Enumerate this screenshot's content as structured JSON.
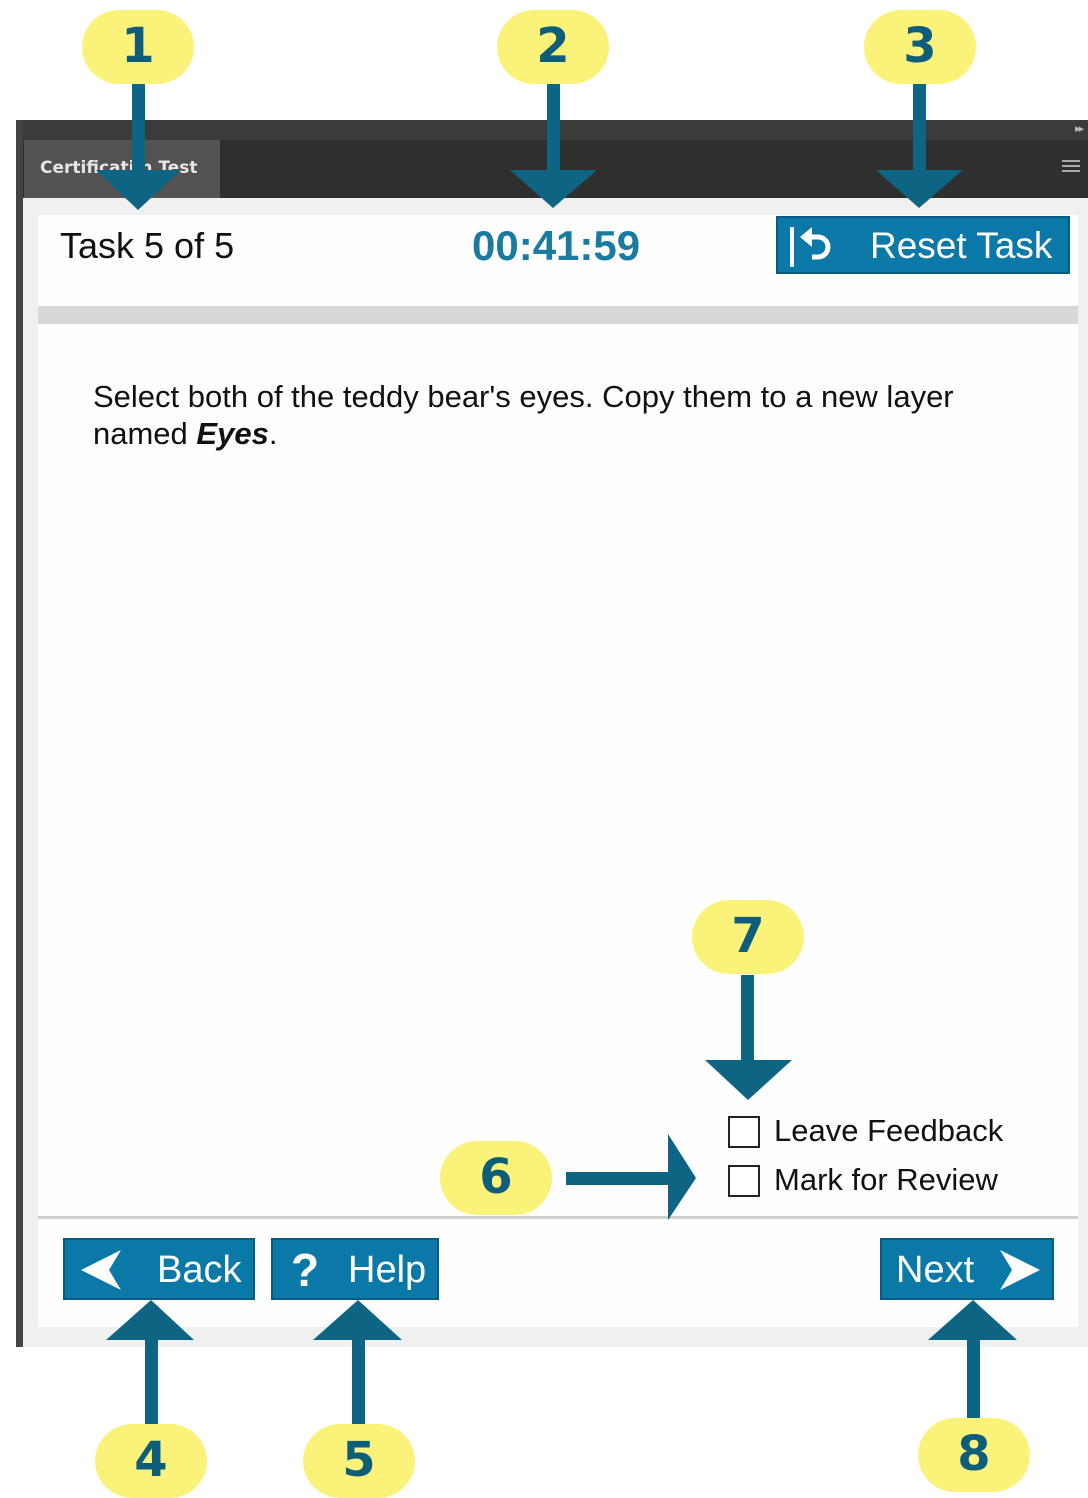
{
  "panel": {
    "tab_label": "Certificati n Test"
  },
  "header": {
    "task_counter": "Task 5 of 5",
    "timer": "00:41:59",
    "reset_label": "Reset Task"
  },
  "task": {
    "instruction_text": "Select both of the teddy bear's eyes. Copy them to a new layer named ",
    "layer_name": "Eyes",
    "end_punct": "."
  },
  "options": {
    "leave_feedback": "Leave Feedback",
    "mark_for_review": "Mark for Review"
  },
  "footer": {
    "back_label": "Back",
    "help_label": "Help",
    "next_label": "Next"
  },
  "callouts": [
    "1",
    "2",
    "3",
    "4",
    "5",
    "6",
    "7",
    "8"
  ],
  "colors": {
    "accent": "#0a79a8",
    "timer": "#1a7aa0",
    "callout_fill": "#fbf27a",
    "callout_arrow": "#0e6483"
  },
  "icons": {
    "reset": "reset-icon",
    "back": "back-arrow-icon",
    "help": "help-icon",
    "next": "next-arrow-icon"
  }
}
